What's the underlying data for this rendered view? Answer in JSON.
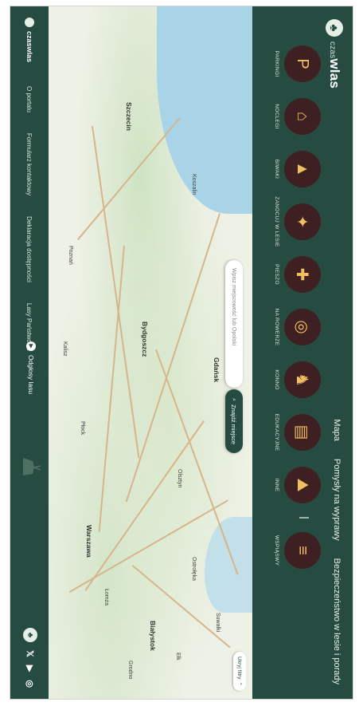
{
  "brand": {
    "name": "czaswlas",
    "prefix": "czas",
    "suffix": "wlas"
  },
  "nav": [
    "Mapa",
    "Pomysły na wyprawy",
    "Bezpieczeństwo w lesie i porady"
  ],
  "categories": [
    {
      "label": "PARKINGI",
      "icon": "parking-icon",
      "glyph": "P"
    },
    {
      "label": "NOCLEGI",
      "icon": "cabin-icon",
      "glyph": "⌂"
    },
    {
      "label": "BIWAKI",
      "icon": "tent-icon",
      "glyph": "▲"
    },
    {
      "label": "ZANOCUJ W LESIE",
      "icon": "map-tent-icon",
      "glyph": "✦"
    },
    {
      "label": "PIESZO",
      "icon": "backpack-icon",
      "glyph": "✚"
    },
    {
      "label": "NA ROWERZE",
      "icon": "bicycle-icon",
      "glyph": "◎"
    },
    {
      "label": "KONNO",
      "icon": "horse-icon",
      "glyph": "♞"
    },
    {
      "label": "EDUKACYJNE",
      "icon": "book-icon",
      "glyph": "▤"
    },
    {
      "label": "INNE",
      "icon": "mountains-icon",
      "glyph": "⛰"
    },
    {
      "label": "WSPIĄSWY",
      "icon": "climbing-icon",
      "glyph": "≡"
    }
  ],
  "search": {
    "placeholder": "Wpisz miejscowość lub Opolski",
    "button": "Znajdź miejsce"
  },
  "layers_button": "Ukryj filtry",
  "map_cities": [
    {
      "name": "Szczecin",
      "big": true
    },
    {
      "name": "Koszalin",
      "big": false
    },
    {
      "name": "Gdańsk",
      "big": true
    },
    {
      "name": "Bydgoszcz",
      "big": true
    },
    {
      "name": "Olsztyn",
      "big": false
    },
    {
      "name": "Białystok",
      "big": true
    },
    {
      "name": "Warszawa",
      "big": true
    },
    {
      "name": "Poznań",
      "big": false
    },
    {
      "name": "Łomża",
      "big": false
    },
    {
      "name": "Ostrołęka",
      "big": false
    },
    {
      "name": "Grodno",
      "big": false
    },
    {
      "name": "Suwałki",
      "big": false
    },
    {
      "name": "Ełk",
      "big": false
    },
    {
      "name": "Płock",
      "big": false
    },
    {
      "name": "Kalisz",
      "big": false
    }
  ],
  "footer": {
    "logo": "czaswlas",
    "links": [
      "O portalu",
      "Formularz kontaktowy",
      "Deklaracja dostępności",
      "Lasy Państwowe"
    ],
    "audio": "Odgłosy lasu",
    "social": [
      "X",
      "youtube",
      "instagram"
    ]
  },
  "colors": {
    "header": "#264b40",
    "category_circle": "#3e1f22",
    "sea": "#a9d3e7"
  }
}
